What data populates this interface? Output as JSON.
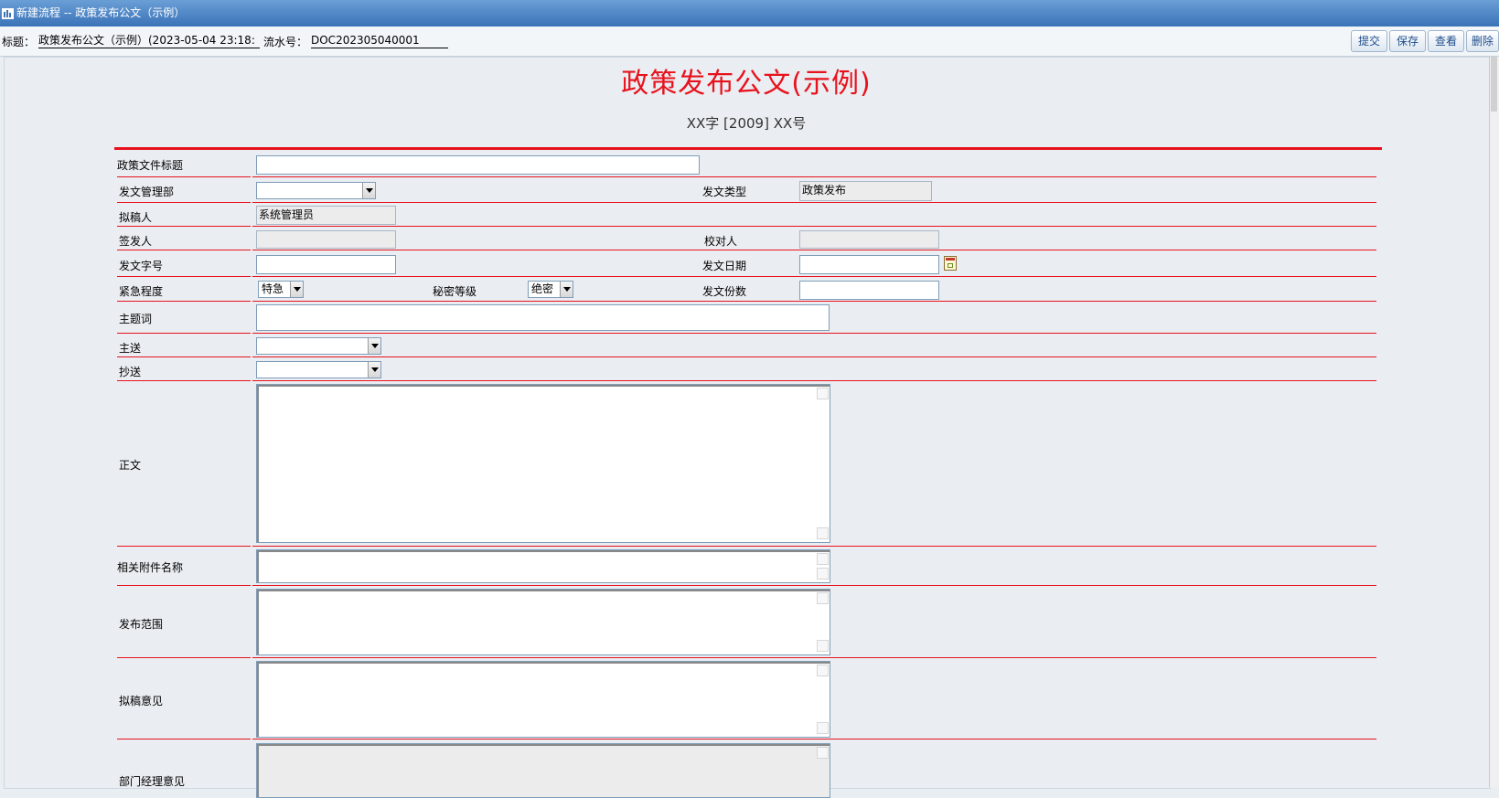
{
  "window": {
    "title": "新建流程 -- 政策发布公文（示例）"
  },
  "toolbar": {
    "title_label": "标题：",
    "title_value": "政策发布公文（示例）(2023-05-04 23:18:",
    "serial_label": "流水号：",
    "serial_value": "DOC202305040001",
    "submit": "提交",
    "save": "保存",
    "view": "查看",
    "delete": "删除"
  },
  "document": {
    "title": "政策发布公文(示例)",
    "subtitle": "XX字  [2009] XX号"
  },
  "form": {
    "policy_title_label": "政策文件标题",
    "policy_title_value": "",
    "dept_label": "发文管理部",
    "dept_value": "",
    "doc_type_label": "发文类型",
    "doc_type_value": "政策发布",
    "drafter_label": "拟稿人",
    "drafter_value": "系统管理员",
    "signer_label": "签发人",
    "signer_value": "",
    "proofreader_label": "校对人",
    "proofreader_value": "",
    "doc_number_label": "发文字号",
    "doc_number_value": "",
    "issue_date_label": "发文日期",
    "issue_date_value": "",
    "urgency_label": "紧急程度",
    "urgency_value": "特急",
    "secrecy_label": "秘密等级",
    "secrecy_value": "绝密",
    "copies_label": "发文份数",
    "copies_value": "",
    "keywords_label": "主题词",
    "keywords_value": "",
    "main_recipient_label": "主送",
    "main_recipient_value": "",
    "cc_label": "抄送",
    "cc_value": "",
    "body_label": "正文",
    "attachments_label": "相关附件名称",
    "scope_label": "发布范围",
    "draft_opinion_label": "拟稿意见",
    "manager_opinion_label": "部门经理意见"
  }
}
